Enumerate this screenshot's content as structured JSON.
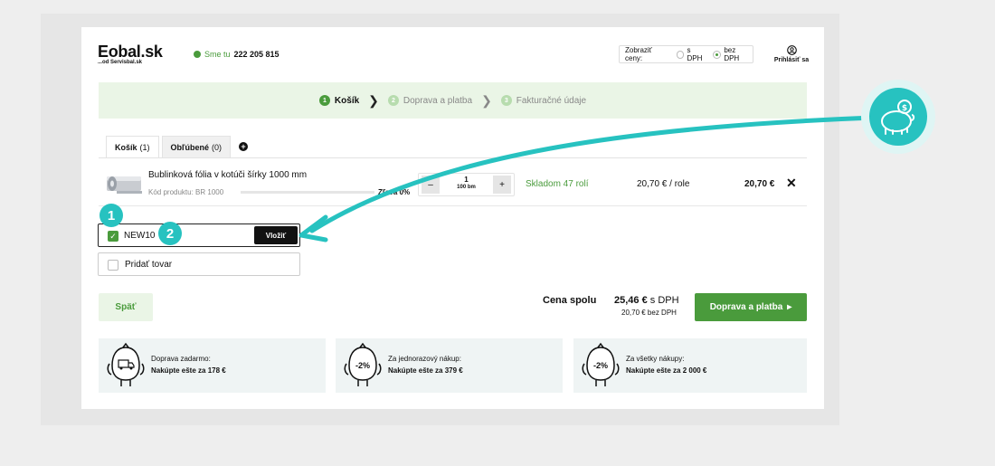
{
  "header": {
    "logo_main": "Eobal.sk",
    "logo_sub": "...od Servisbal.sk",
    "phone_label": "Sme tu",
    "phone_number": "222 205 815",
    "price_toggle_label": "Zobraziť ceny:",
    "price_option_with_vat": "s DPH",
    "price_option_without_vat": "bez DPH",
    "price_option_selected": "bez DPH",
    "login_label": "Prihlásiť sa"
  },
  "steps": [
    {
      "num": "1",
      "label": "Košík",
      "active": true
    },
    {
      "num": "2",
      "label": "Doprava a platba",
      "active": false
    },
    {
      "num": "3",
      "label": "Fakturačné údaje",
      "active": false
    }
  ],
  "tabs": [
    {
      "label": "Košík",
      "count": "(1)"
    },
    {
      "label": "Obľúbené",
      "count": "(0)"
    }
  ],
  "product": {
    "name": "Bublinková fólia v kotúči šírky 1000 mm",
    "code": "Kód produktu: BR 1000",
    "discount": "Zľava 0%",
    "discount_progress": 0,
    "qty_value": "1",
    "qty_unit": "100 bm",
    "qty_minus": "–",
    "qty_plus": "+",
    "stock": "Skladom 47 rolí",
    "unit_price": "20,70 € / role",
    "total": "20,70 €",
    "remove": "✕"
  },
  "coupon": {
    "checked": true,
    "code": "NEW10",
    "apply_label": "Vložiť"
  },
  "add_item": {
    "label": "Pridať tovar"
  },
  "annotations": {
    "badge1": "1",
    "badge2": "2"
  },
  "summary": {
    "back_label": "Späť",
    "total_label": "Cena spolu",
    "total_with_vat": "25,46 €",
    "total_with_vat_suffix": "s DPH",
    "total_without_vat": "20,70 € bez DPH",
    "cta_label": "Doprava a platba"
  },
  "promos": [
    {
      "icon": "delivery-truck-icon",
      "badge": "",
      "line1": "Doprava zadarmo:",
      "line2": "Nakúpte ešte za 178 €"
    },
    {
      "icon": "discount-icon",
      "badge": "-2%",
      "line1": "Za jednorazový nákup:",
      "line2": "Nakúpte ešte za 379 €"
    },
    {
      "icon": "discount-icon",
      "badge": "-2%",
      "line1": "Za všetky nákupy:",
      "line2": "Nakúpte ešte za 2 000 €"
    }
  ],
  "colors": {
    "accent": "#4a9b3c",
    "annotation": "#27c2c0",
    "light_green": "#eaf5e6"
  }
}
